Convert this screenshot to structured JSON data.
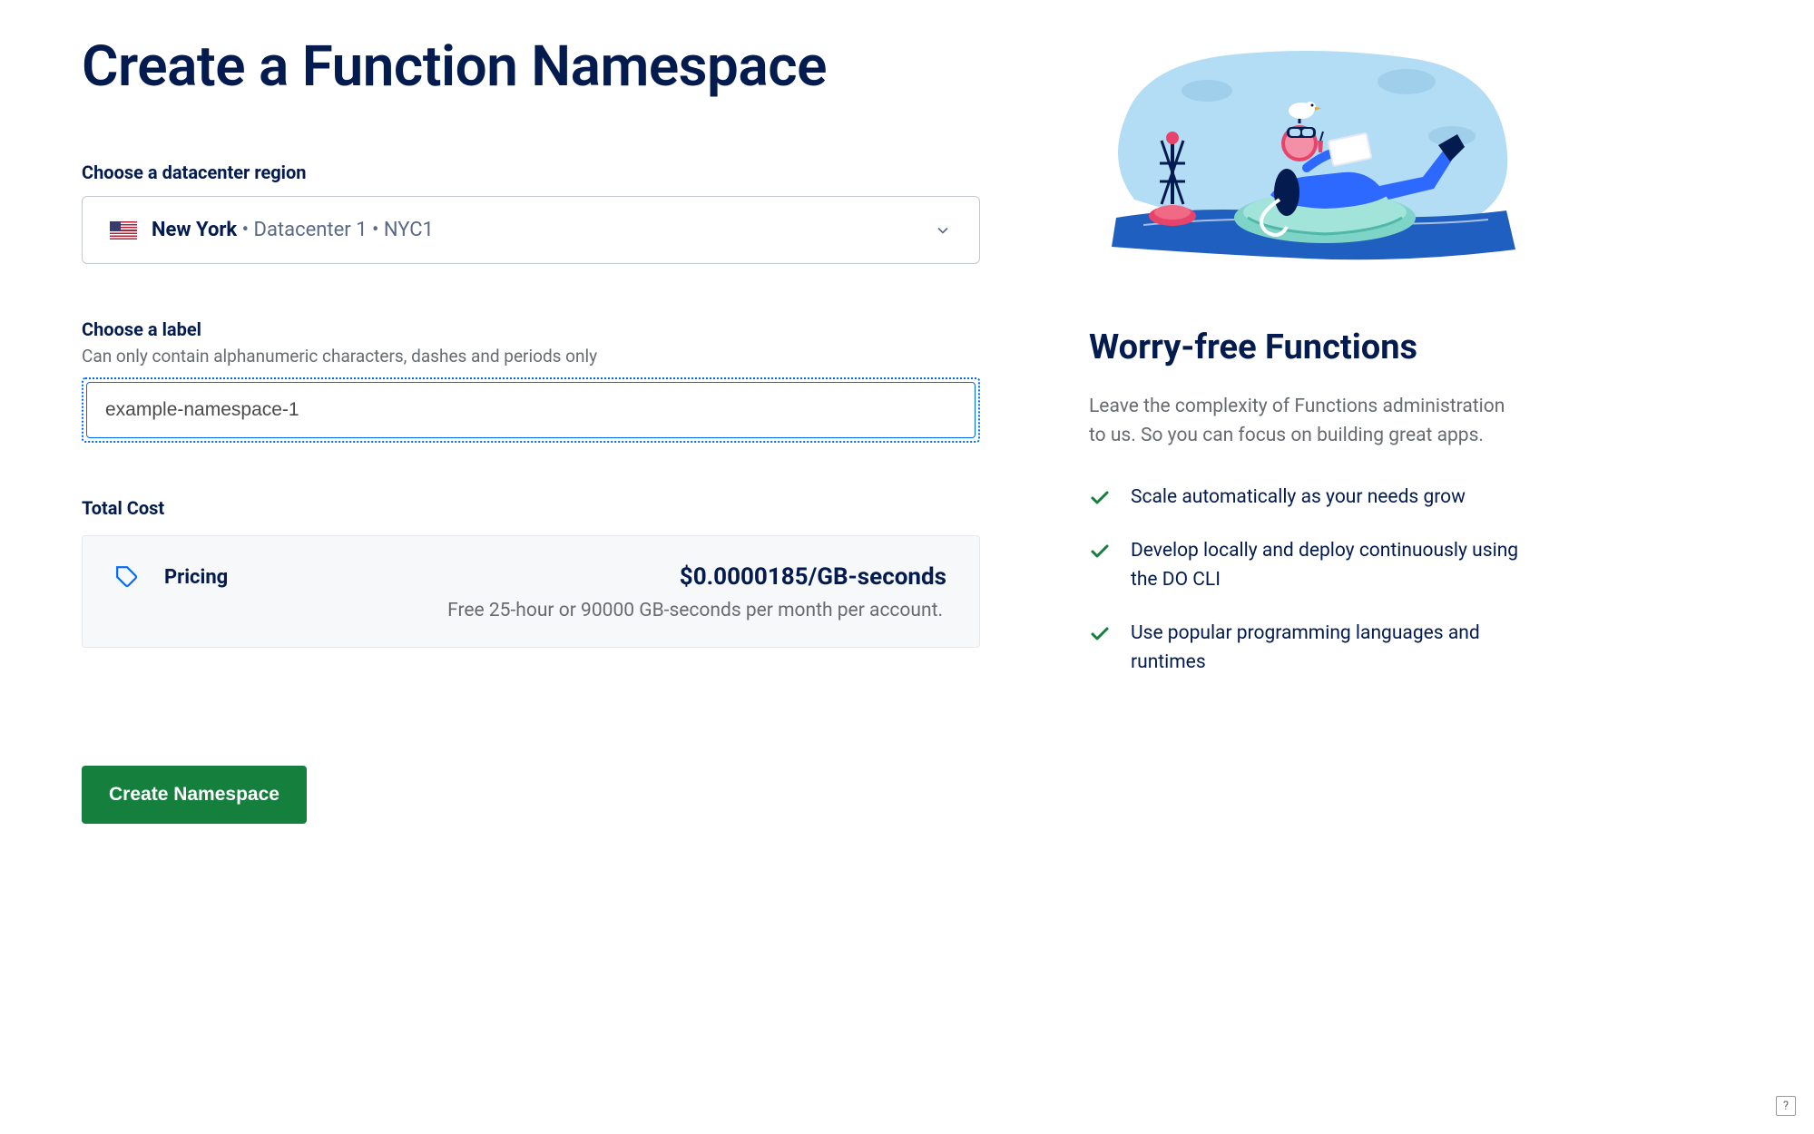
{
  "page": {
    "title": "Create a Function Namespace"
  },
  "region": {
    "label": "Choose a datacenter region",
    "selected_city": "New York",
    "selected_detail": " • Datacenter 1 • NYC1"
  },
  "label_section": {
    "label": "Choose a label",
    "hint": "Can only contain alphanumeric characters, dashes and periods only",
    "value": "example-namespace-1"
  },
  "cost": {
    "label": "Total Cost",
    "pricing_label": "Pricing",
    "pricing_value": "$0.0000185/GB-seconds",
    "pricing_note": "Free 25-hour or 90000 GB-seconds per month per account."
  },
  "actions": {
    "create_label": "Create Namespace"
  },
  "sidebar": {
    "title": "Worry-free Functions",
    "description": "Leave the complexity of Functions administration to us. So you can focus on building great apps.",
    "benefits": [
      "Scale automatically as your needs grow",
      "Develop locally and deploy continuously using the DO CLI",
      "Use popular programming languages and runtimes"
    ]
  },
  "help": {
    "label": "?"
  }
}
